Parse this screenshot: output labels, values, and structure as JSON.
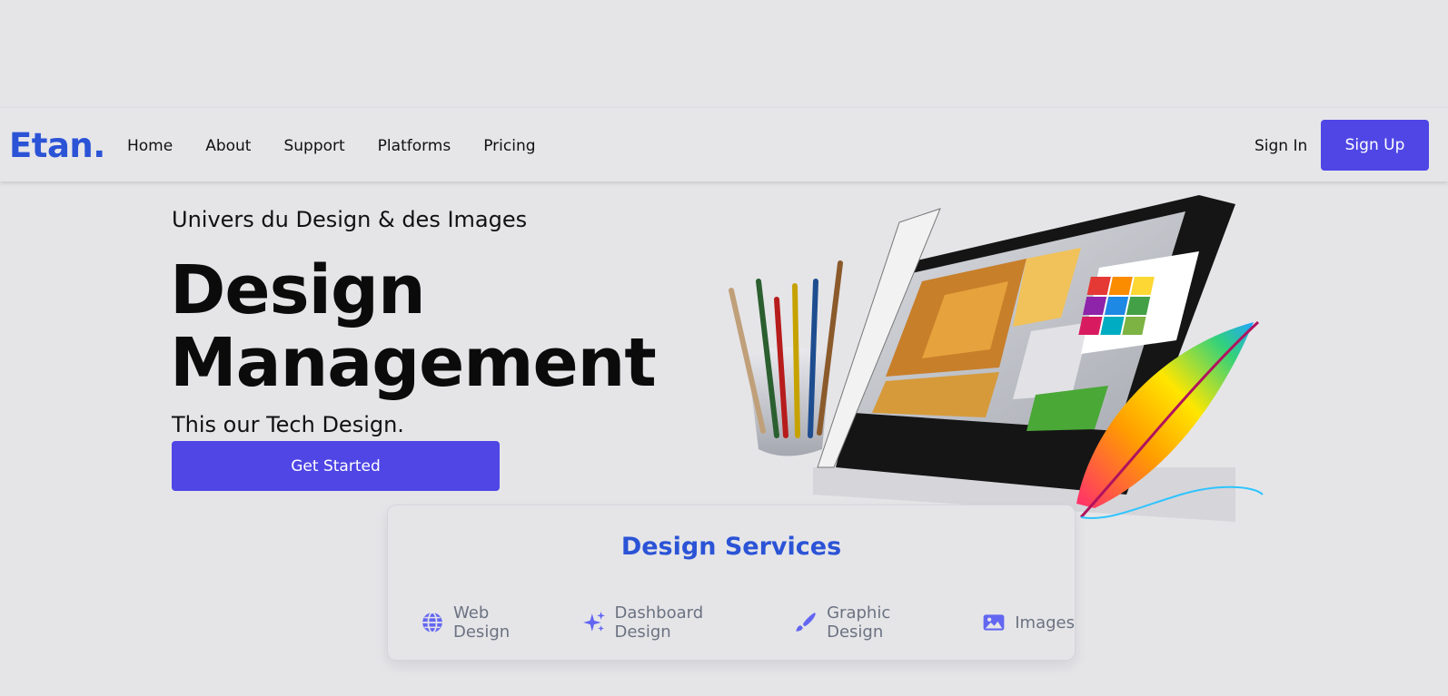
{
  "brand": {
    "logo": "Etan.",
    "accent": "#2b53d6",
    "button_color": "#4f46e5"
  },
  "nav": {
    "items": [
      {
        "label": "Home"
      },
      {
        "label": "About"
      },
      {
        "label": "Support"
      },
      {
        "label": "Platforms"
      },
      {
        "label": "Pricing"
      }
    ],
    "sign_in": "Sign In",
    "sign_up": "Sign Up"
  },
  "hero": {
    "subtitle": "Univers du Design & des Images",
    "title_line1": "Design",
    "title_line2": "Management",
    "description": "This our Tech Design.",
    "cta": "Get Started",
    "image": "design-tablet-illustration"
  },
  "services": {
    "title": "Design Services",
    "items": [
      {
        "label": "Web Design",
        "icon": "globe-icon"
      },
      {
        "label": "Dashboard Design",
        "icon": "sparkles-icon"
      },
      {
        "label": "Graphic Design",
        "icon": "paintbrush-icon"
      },
      {
        "label": "Images",
        "icon": "image-icon"
      }
    ]
  }
}
